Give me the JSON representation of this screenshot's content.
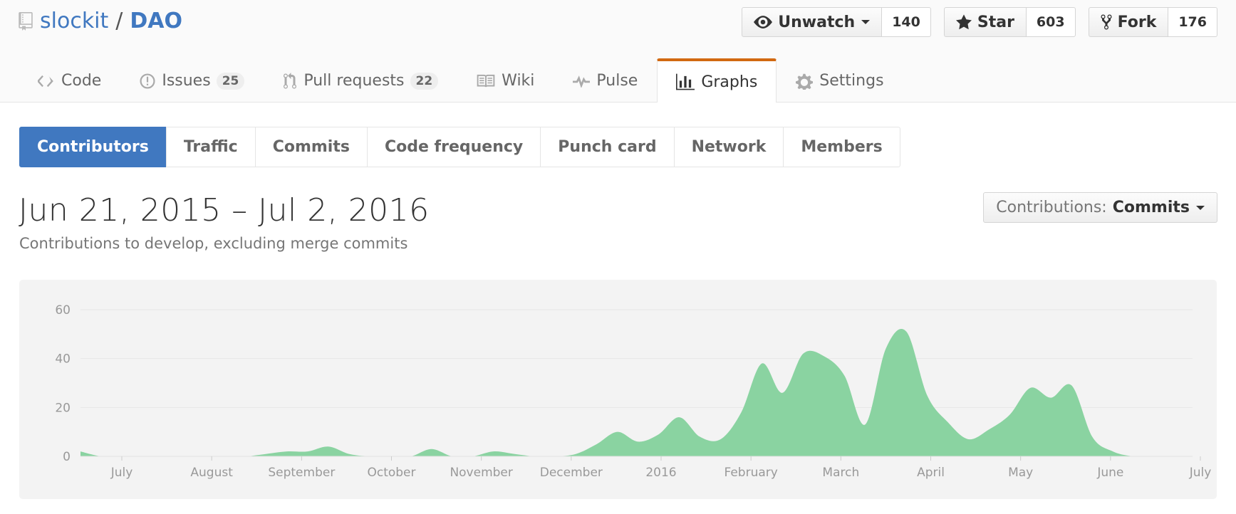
{
  "repo": {
    "owner": "slockit",
    "separator": "/",
    "name": "DAO"
  },
  "actions": [
    {
      "label": "Unwatch",
      "count": "140",
      "icon": "eye-icon"
    },
    {
      "label": "Star",
      "count": "603",
      "icon": "star-icon"
    },
    {
      "label": "Fork",
      "count": "176",
      "icon": "fork-icon"
    }
  ],
  "reponav": [
    {
      "label": "Code",
      "icon": "code-icon"
    },
    {
      "label": "Issues",
      "counter": "25",
      "icon": "issue-icon"
    },
    {
      "label": "Pull requests",
      "counter": "22",
      "icon": "pull-request-icon"
    },
    {
      "label": "Wiki",
      "icon": "book-icon"
    },
    {
      "label": "Pulse",
      "icon": "pulse-icon"
    },
    {
      "label": "Graphs",
      "icon": "graph-icon",
      "selected": true
    },
    {
      "label": "Settings",
      "icon": "gear-icon"
    }
  ],
  "subnav": [
    "Contributors",
    "Traffic",
    "Commits",
    "Code frequency",
    "Punch card",
    "Network",
    "Members"
  ],
  "subnav_selected": "Contributors",
  "range_title": "Jun 21, 2015 – Jul 2, 2016",
  "range_subtitle": "Contributions to develop, excluding merge commits",
  "contributions_select": {
    "label": "Contributions:",
    "value": "Commits"
  },
  "colors": {
    "accent": "#4078c0",
    "tab_highlight": "#d26911",
    "area": "#8ad3a1"
  },
  "chart_data": {
    "type": "area",
    "x_tick_labels": [
      "July",
      "August",
      "September",
      "October",
      "November",
      "December",
      "2016",
      "February",
      "March",
      "April",
      "May",
      "June",
      "July"
    ],
    "y_ticks": [
      0,
      20,
      40,
      60
    ],
    "ylim": [
      0,
      60
    ],
    "xlim": [
      "2015-06-21",
      "2016-07-02"
    ],
    "grid": true,
    "x": [
      "2015-06-21",
      "2015-06-28",
      "2015-07-05",
      "2015-07-12",
      "2015-07-19",
      "2015-07-26",
      "2015-08-02",
      "2015-08-09",
      "2015-08-16",
      "2015-08-23",
      "2015-08-30",
      "2015-09-06",
      "2015-09-13",
      "2015-09-20",
      "2015-09-27",
      "2015-10-04",
      "2015-10-11",
      "2015-10-18",
      "2015-10-25",
      "2015-11-01",
      "2015-11-08",
      "2015-11-15",
      "2015-11-22",
      "2015-11-29",
      "2015-12-06",
      "2015-12-13",
      "2015-12-20",
      "2015-12-27",
      "2016-01-03",
      "2016-01-10",
      "2016-01-17",
      "2016-01-24",
      "2016-01-31",
      "2016-02-07",
      "2016-02-14",
      "2016-02-21",
      "2016-02-28",
      "2016-03-06",
      "2016-03-13",
      "2016-03-20",
      "2016-03-27",
      "2016-04-03",
      "2016-04-10",
      "2016-04-17",
      "2016-04-24",
      "2016-05-01",
      "2016-05-08",
      "2016-05-15",
      "2016-05-22",
      "2016-05-29",
      "2016-06-05",
      "2016-06-12",
      "2016-06-19",
      "2016-06-26",
      "2016-07-02"
    ],
    "values": [
      2,
      0,
      0,
      0,
      0,
      0,
      0,
      0,
      0,
      1,
      2,
      2,
      4,
      1,
      0,
      0,
      0,
      3,
      0,
      0,
      2,
      1,
      0,
      0,
      1,
      5,
      10,
      6,
      9,
      16,
      8,
      7,
      18,
      38,
      26,
      42,
      41,
      33,
      13,
      44,
      51,
      25,
      14,
      7,
      11,
      17,
      28,
      24,
      29,
      8,
      2,
      0,
      0,
      0,
      0
    ]
  }
}
